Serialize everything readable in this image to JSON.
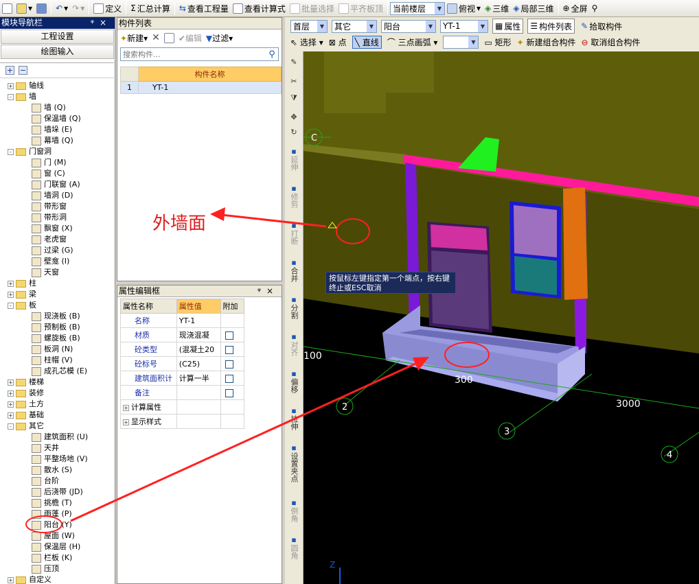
{
  "toolbar": {
    "define": "定义",
    "summary": "汇总计算",
    "view_quantity": "查看工程量",
    "view_formula": "查看计算式",
    "batch_select": "批量选择",
    "flush_slab": "平齐板顶",
    "current_floor": "当前楼层",
    "top_view": "俯视",
    "three_d": "三维",
    "local_3d": "局部三维",
    "fullscreen": "全屏"
  },
  "left_nav": {
    "title": "模块导航栏",
    "project_settings": "工程设置",
    "drawing_input": "绘图输入",
    "tree": [
      {
        "label": "轴线",
        "level": 0,
        "exp": "+"
      },
      {
        "label": "墙",
        "level": 0,
        "exp": "-"
      },
      {
        "label": "墙 (Q)",
        "level": 1
      },
      {
        "label": "保温墙 (Q)",
        "level": 1
      },
      {
        "label": "墙垛 (E)",
        "level": 1
      },
      {
        "label": "幕墙 (Q)",
        "level": 1
      },
      {
        "label": "门窗洞",
        "level": 0,
        "exp": "-"
      },
      {
        "label": "门 (M)",
        "level": 1
      },
      {
        "label": "窗 (C)",
        "level": 1
      },
      {
        "label": "门联窗 (A)",
        "level": 1
      },
      {
        "label": "墙洞 (D)",
        "level": 1
      },
      {
        "label": "带形窗",
        "level": 1
      },
      {
        "label": "带形洞",
        "level": 1
      },
      {
        "label": "飘窗 (X)",
        "level": 1
      },
      {
        "label": "老虎窗",
        "level": 1
      },
      {
        "label": "过梁 (G)",
        "level": 1
      },
      {
        "label": "壁龛 (I)",
        "level": 1
      },
      {
        "label": "天窗",
        "level": 1
      },
      {
        "label": "柱",
        "level": 0,
        "exp": "+"
      },
      {
        "label": "梁",
        "level": 0,
        "exp": "+"
      },
      {
        "label": "板",
        "level": 0,
        "exp": "-"
      },
      {
        "label": "现浇板 (B)",
        "level": 1
      },
      {
        "label": "预制板 (B)",
        "level": 1
      },
      {
        "label": "螺旋板 (B)",
        "level": 1
      },
      {
        "label": "板洞 (N)",
        "level": 1
      },
      {
        "label": "柱帽 (V)",
        "level": 1
      },
      {
        "label": "成孔芯模 (E)",
        "level": 1
      },
      {
        "label": "楼梯",
        "level": 0,
        "exp": "+"
      },
      {
        "label": "装修",
        "level": 0,
        "exp": "+"
      },
      {
        "label": "土方",
        "level": 0,
        "exp": "+"
      },
      {
        "label": "基础",
        "level": 0,
        "exp": "+"
      },
      {
        "label": "其它",
        "level": 0,
        "exp": "-"
      },
      {
        "label": "建筑面积 (U)",
        "level": 1
      },
      {
        "label": "天井",
        "level": 1
      },
      {
        "label": "平整场地 (V)",
        "level": 1
      },
      {
        "label": "散水 (S)",
        "level": 1
      },
      {
        "label": "台阶",
        "level": 1
      },
      {
        "label": "后浇带 (JD)",
        "level": 1
      },
      {
        "label": "挑檐 (T)",
        "level": 1
      },
      {
        "label": "雨蓬 (P)",
        "level": 1
      },
      {
        "label": "阳台 (Y)",
        "level": 1
      },
      {
        "label": "屋面 (W)",
        "level": 1
      },
      {
        "label": "保温层 (H)",
        "level": 1
      },
      {
        "label": "栏板 (K)",
        "level": 1
      },
      {
        "label": "压顶",
        "level": 1
      },
      {
        "label": "自定义",
        "level": 0,
        "exp": "+"
      }
    ]
  },
  "component_list": {
    "title": "构件列表",
    "new": "新建",
    "edit": "编辑",
    "filter": "过滤",
    "search_placeholder": "搜索构件...",
    "col_name": "构件名称",
    "rows": [
      {
        "idx": "1",
        "name": "YT-1"
      }
    ]
  },
  "property_panel": {
    "title": "属性编辑框",
    "col_name": "属性名称",
    "col_value": "属性值",
    "col_extra": "附加",
    "rows": [
      {
        "name": "名称",
        "value": "YT-1",
        "check": false
      },
      {
        "name": "材质",
        "value": "现浇混凝",
        "check": true
      },
      {
        "name": "砼类型",
        "value": "(混凝土20",
        "check": true
      },
      {
        "name": "砼标号",
        "value": "(C25)",
        "check": true
      },
      {
        "name": "建筑面积计",
        "value": "计算一半",
        "check": true
      },
      {
        "name": "备注",
        "value": "",
        "check": true
      }
    ],
    "groups": [
      "计算属性",
      "显示样式"
    ]
  },
  "layer_bar": {
    "floor": "首层",
    "type": "其它",
    "category": "阳台",
    "component": "YT-1",
    "attributes": "属性",
    "component_list": "构件列表",
    "pick": "拾取构件"
  },
  "draw_bar": {
    "select": "选择",
    "point": "点",
    "line": "直线",
    "arc": "三点画弧",
    "rect": "矩形",
    "new_group": "新建组合构件",
    "cancel_group": "取消组合构件"
  },
  "vertical_tools": [
    "延伸",
    "修剪",
    "打断",
    "合并",
    "分割",
    "对齐",
    "偏移",
    "拉伸",
    "设置夹点",
    "倒角",
    "圆角"
  ],
  "viewport": {
    "tooltip": "按鼠标左键指定第一个端点，按右键终止或ESC取消",
    "annotation": "外墙面",
    "axis_labels": [
      "C",
      "2",
      "3",
      "4"
    ],
    "dims": [
      "3000",
      "300",
      "100"
    ],
    "z_label": "Z"
  },
  "colors": {
    "title_bar": "#0a246a",
    "grid_header": "#ffcc66",
    "annotation": "#e02020",
    "wall": "#5c5c08"
  }
}
